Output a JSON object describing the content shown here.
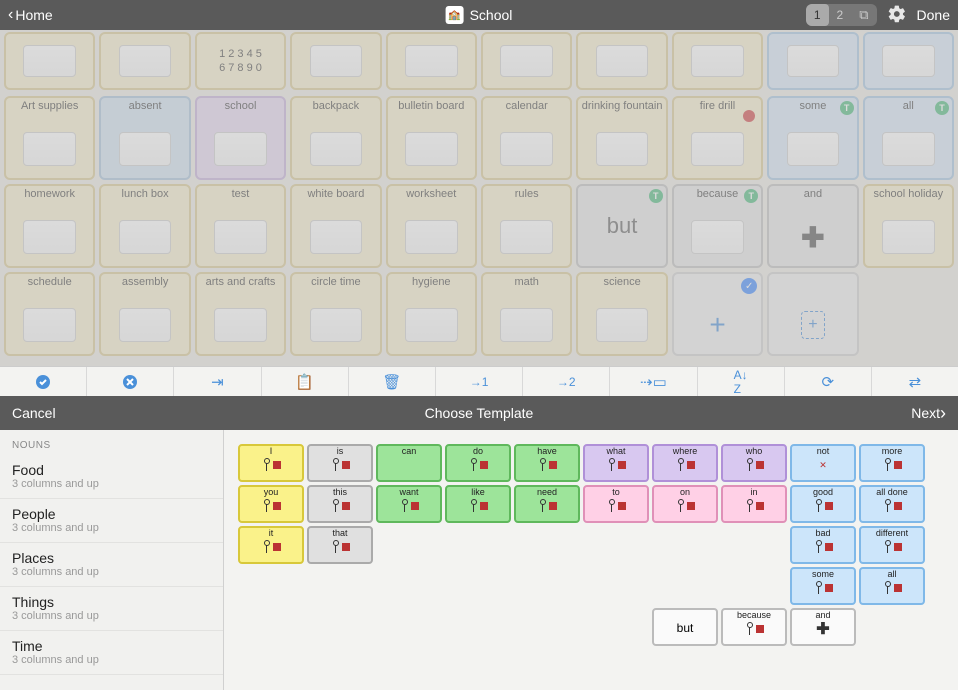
{
  "header": {
    "home": "Home",
    "title": "School",
    "pages": [
      "1",
      "2"
    ],
    "active_page": 0,
    "done": "Done"
  },
  "row0": [
    {
      "label": "",
      "variant": "ltyellow"
    },
    {
      "label": "",
      "variant": "ltyellow"
    },
    {
      "label": "1 2 3 4 5\n6 7 8 9 0",
      "variant": "ltyellow",
      "text_as_image": true
    },
    {
      "label": "",
      "variant": "ltyellow"
    },
    {
      "label": "",
      "variant": "ltyellow"
    },
    {
      "label": "",
      "variant": "ltyellow"
    },
    {
      "label": "",
      "variant": "ltyellow"
    },
    {
      "label": "",
      "variant": "ltyellow"
    },
    {
      "label": "",
      "variant": "bluecell"
    },
    {
      "label": "",
      "variant": "bluecell"
    }
  ],
  "grid": [
    {
      "label": "Art supplies",
      "variant": "ltyellow"
    },
    {
      "label": "absent",
      "variant": "blue"
    },
    {
      "label": "school",
      "variant": "purple"
    },
    {
      "label": "backpack",
      "variant": "ltyellow"
    },
    {
      "label": "bulletin board",
      "variant": "ltyellow"
    },
    {
      "label": "calendar",
      "variant": "ltyellow"
    },
    {
      "label": "drinking fountain",
      "variant": "ltyellow"
    },
    {
      "label": "fire drill",
      "variant": "ltyellow",
      "badge": "red"
    },
    {
      "label": "some",
      "variant": "bluecell",
      "badge": "t"
    },
    {
      "label": "all",
      "variant": "bluecell",
      "badge": "t"
    },
    {
      "label": "homework",
      "variant": "ltyellow"
    },
    {
      "label": "lunch box",
      "variant": "ltyellow"
    },
    {
      "label": "test",
      "variant": "ltyellow"
    },
    {
      "label": "white board",
      "variant": "ltyellow"
    },
    {
      "label": "worksheet",
      "variant": "ltyellow"
    },
    {
      "label": "rules",
      "variant": "ltyellow"
    },
    {
      "label": "but",
      "variant": "grey",
      "big_text": true,
      "badge": "t"
    },
    {
      "label": "because",
      "variant": "grey",
      "badge": "t"
    },
    {
      "label": "and",
      "variant": "grey",
      "plus": true
    },
    {
      "label": "school holiday",
      "variant": "ltyellow"
    },
    {
      "label": "schedule",
      "variant": "ltyellow"
    },
    {
      "label": "assembly",
      "variant": "ltyellow"
    },
    {
      "label": "arts and crafts",
      "variant": "ltyellow"
    },
    {
      "label": "circle time",
      "variant": "ltyellow"
    },
    {
      "label": "hygiene",
      "variant": "ltyellow"
    },
    {
      "label": "math",
      "variant": "ltyellow"
    },
    {
      "label": "science",
      "variant": "ltyellow"
    },
    {
      "label": "",
      "variant": "ltgrey",
      "badge": "check",
      "add": true
    },
    {
      "label": "",
      "variant": "ltgrey",
      "add_page": true
    },
    {
      "label": "",
      "variant": "none"
    }
  ],
  "toolbar_icons": [
    "check-filled",
    "x-filled",
    "import",
    "paste",
    "trash",
    "plus-1",
    "plus-2",
    "open-folder",
    "sort",
    "refresh",
    "swap"
  ],
  "template_header": {
    "cancel": "Cancel",
    "title": "Choose Template",
    "next": "Next"
  },
  "sidebar": {
    "section": "NOUNS",
    "items": [
      {
        "title": "Food",
        "sub": "3 columns and up"
      },
      {
        "title": "People",
        "sub": "3 columns and up"
      },
      {
        "title": "Places",
        "sub": "3 columns and up"
      },
      {
        "title": "Things",
        "sub": "3 columns and up"
      },
      {
        "title": "Time",
        "sub": "3 columns and up"
      }
    ]
  },
  "template_grid": {
    "cells": [
      {
        "r": 0,
        "c": 0,
        "label": "I",
        "v": "yellow"
      },
      {
        "r": 0,
        "c": 1,
        "label": "is",
        "v": "grey"
      },
      {
        "r": 0,
        "c": 2,
        "label": "can",
        "v": "green"
      },
      {
        "r": 0,
        "c": 3,
        "label": "do",
        "v": "green"
      },
      {
        "r": 0,
        "c": 4,
        "label": "have",
        "v": "green"
      },
      {
        "r": 0,
        "c": 5,
        "label": "what",
        "v": "purple"
      },
      {
        "r": 0,
        "c": 6,
        "label": "where",
        "v": "purple"
      },
      {
        "r": 0,
        "c": 7,
        "label": "who",
        "v": "purple"
      },
      {
        "r": 0,
        "c": 8,
        "label": "not",
        "v": "blue"
      },
      {
        "r": 0,
        "c": 9,
        "label": "more",
        "v": "blue"
      },
      {
        "r": 1,
        "c": 0,
        "label": "you",
        "v": "yellow"
      },
      {
        "r": 1,
        "c": 1,
        "label": "this",
        "v": "grey"
      },
      {
        "r": 1,
        "c": 2,
        "label": "want",
        "v": "green"
      },
      {
        "r": 1,
        "c": 3,
        "label": "like",
        "v": "green"
      },
      {
        "r": 1,
        "c": 4,
        "label": "need",
        "v": "green"
      },
      {
        "r": 1,
        "c": 5,
        "label": "to",
        "v": "pink"
      },
      {
        "r": 1,
        "c": 6,
        "label": "on",
        "v": "pink"
      },
      {
        "r": 1,
        "c": 7,
        "label": "in",
        "v": "pink"
      },
      {
        "r": 1,
        "c": 8,
        "label": "good",
        "v": "blue"
      },
      {
        "r": 1,
        "c": 9,
        "label": "all done",
        "v": "blue"
      },
      {
        "r": 2,
        "c": 0,
        "label": "it",
        "v": "yellow"
      },
      {
        "r": 2,
        "c": 1,
        "label": "that",
        "v": "grey"
      },
      {
        "r": 2,
        "c": 8,
        "label": "bad",
        "v": "blue"
      },
      {
        "r": 2,
        "c": 9,
        "label": "different",
        "v": "blue"
      },
      {
        "r": 3,
        "c": 8,
        "label": "some",
        "v": "blue"
      },
      {
        "r": 3,
        "c": 9,
        "label": "all",
        "v": "blue"
      },
      {
        "r": 4,
        "c": 6,
        "label": "but",
        "v": "white"
      },
      {
        "r": 4,
        "c": 7,
        "label": "because",
        "v": "white"
      },
      {
        "r": 4,
        "c": 8,
        "label": "and",
        "v": "white"
      }
    ]
  }
}
